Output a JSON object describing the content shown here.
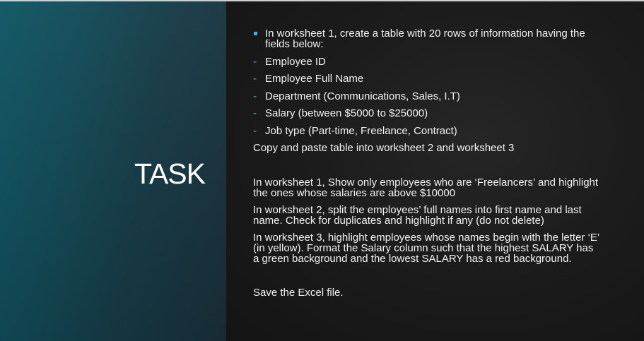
{
  "slide": {
    "title": "TASK",
    "intro": "In worksheet 1, create a table with 20 rows of information having the fields below:",
    "dash_symbol": "-",
    "fields": [
      "Employee ID",
      "Employee Full Name",
      "Department (Communications, Sales, I.T)",
      "Salary (between $5000 to $25000)",
      "Job type (Part-time, Freelance, Contract)"
    ],
    "copy_instruction": "Copy and paste table into worksheet 2 and worksheet 3",
    "worksheet1_instruction": "In worksheet 1, Show only employees who are ‘Freelancers’ and highlight the ones whose salaries are above $10000",
    "worksheet2_instruction": "In worksheet 2, split the employees’ full names into first name and last name. Check for duplicates and highlight if any (do not delete)",
    "worksheet3_instruction": "In worksheet 3, highlight employees whose names begin with the letter ‘E’ (in yellow). Format the Salary column such that the highest SALARY has a green background and the lowest SALARY has a red background.",
    "save_instruction": "Save the Excel file."
  },
  "colors": {
    "accent": "#33b4e6",
    "left_panel": "#124a57",
    "right_panel": "#1c1c1c",
    "text": "#f2f2f2"
  }
}
